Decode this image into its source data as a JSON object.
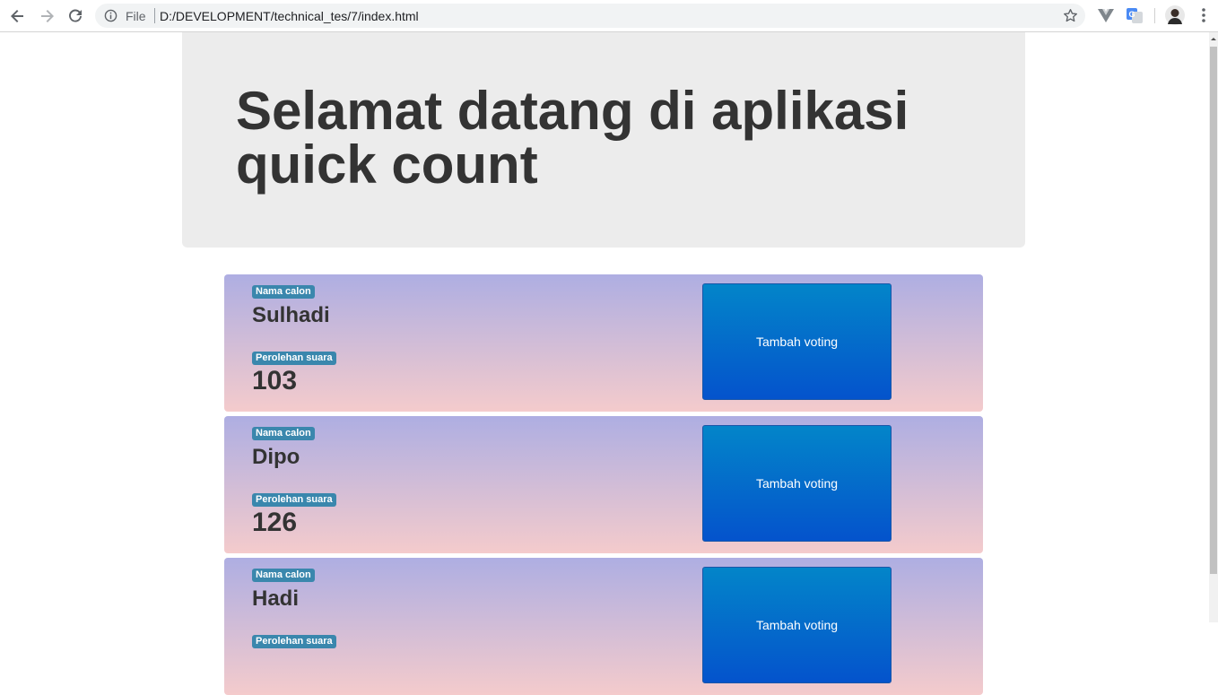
{
  "browser": {
    "scheme_label": "File",
    "url": "D:/DEVELOPMENT/technical_tes/7/index.html",
    "icons": [
      "back-icon",
      "forward-icon",
      "reload-icon",
      "info-icon",
      "star-icon",
      "vuejs-extension-icon",
      "translate-extension-icon",
      "profile-avatar",
      "menu-icon"
    ]
  },
  "page": {
    "heading": "Selamat datang di aplikasi quick count",
    "candidates": [
      {
        "name_badge": "Nama calon",
        "name": "Sulhadi",
        "votes_badge": "Perolehan suara",
        "votes": "103",
        "button": "Tambah voting"
      },
      {
        "name_badge": "Nama calon",
        "name": "Dipo",
        "votes_badge": "Perolehan suara",
        "votes": "126",
        "button": "Tambah voting"
      },
      {
        "name_badge": "Nama calon",
        "name": "Hadi",
        "votes_badge": "Perolehan suara",
        "votes": "",
        "button": "Tambah voting"
      }
    ]
  },
  "colors": {
    "jumbotron_bg": "#ececec",
    "card_gradient_top": "#aeaee2",
    "card_gradient_bottom": "#f4cbcc",
    "badge": "#3a87ad",
    "button_top": "#0385c9",
    "button_bottom": "#0453cc"
  }
}
